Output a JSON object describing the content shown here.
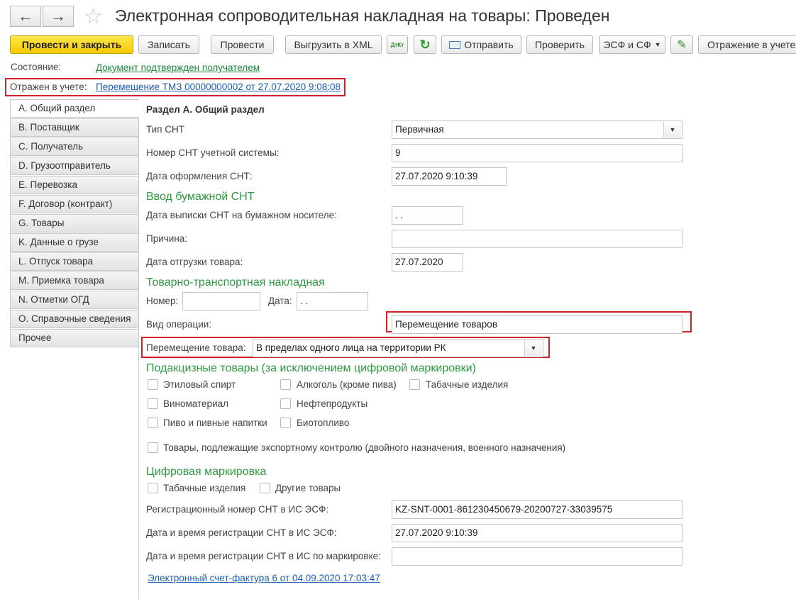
{
  "window": {
    "title": "Электронная сопроводительная накладная на товары: Проведен"
  },
  "toolbar": {
    "post_close": "Провести и закрыть",
    "save": "Записать",
    "post": "Провести",
    "export_xml": "Выгрузить в XML",
    "dtkt_icon_text": "ДтКт",
    "send": "Отправить",
    "check": "Проверить",
    "esf": "ЭСФ и СФ",
    "reflection": "Отражение в учете"
  },
  "status": {
    "label": "Состояние:",
    "value": "Документ подтвержден получателем"
  },
  "reflected": {
    "label": "Отражен в учете:",
    "value": "Перемещение ТМЗ 00000000002 от 27.07.2020 9:08:08"
  },
  "sections": [
    {
      "label": "А. Общий раздел"
    },
    {
      "label": "В. Поставщик"
    },
    {
      "label": "С. Получатель"
    },
    {
      "label": "D. Грузоотправитель"
    },
    {
      "label": "Е. Перевозка"
    },
    {
      "label": "F. Договор (контракт)"
    },
    {
      "label": "G. Товары"
    },
    {
      "label": "K. Данные о грузе"
    },
    {
      "label": "L. Отпуск товара"
    },
    {
      "label": "M. Приемка товара"
    },
    {
      "label": "N. Отметки ОГД"
    },
    {
      "label": "O. Справочные сведения"
    },
    {
      "label": "Прочее"
    }
  ],
  "form": {
    "heading": "Раздел А. Общий раздел",
    "snt_type": {
      "label": "Тип СНТ",
      "value": "Первичная"
    },
    "snt_number": {
      "label": "Номер СНТ учетной системы:",
      "value": "9"
    },
    "snt_date": {
      "label": "Дата оформления СНТ:",
      "value": "27.07.2020  9:10:39"
    },
    "paper_heading": "Ввод бумажной СНТ",
    "paper_date": {
      "label": "Дата выписки СНТ на бумажном носителе:",
      "value": " .  ."
    },
    "reason": {
      "label": "Причина:",
      "value": ""
    },
    "shipment_date": {
      "label": "Дата отгрузки товара:",
      "value": "27.07.2020"
    },
    "ttn_heading": "Товарно-транспортная накладная",
    "ttn_number": {
      "label": "Номер:",
      "value": ""
    },
    "ttn_date": {
      "label": "Дата:",
      "value": " .  ."
    },
    "operation": {
      "label": "Вид операции:",
      "value": "Перемещение товаров"
    },
    "movement": {
      "label": "Перемещение товара:",
      "value": "В пределах одного лица на территории РК"
    },
    "excise_heading": "Подакцизные товары (за исключением цифровой маркировки)",
    "excise": {
      "ethyl": "Этиловый спирт",
      "alcohol": "Алкоголь (кроме пива)",
      "tobacco": "Табачные изделия",
      "wine": "Виноматериал",
      "oil": "Нефтепродукты",
      "beer": "Пиво и пивные напитки",
      "biofuel": "Биотопливо",
      "export_control": "Товары, подлежащие экспортному контролю (двойного назначения, военного назначения)"
    },
    "digital_heading": "Цифровая маркировка",
    "digital": {
      "tobacco": "Табачные изделия",
      "other": "Другие товары"
    },
    "reg_number": {
      "label": "Регистрационный номер СНТ в ИС ЭСФ:",
      "value": "KZ-SNT-0001-861230450679-20200727-33039575"
    },
    "reg_date": {
      "label": "Дата и время регистрации СНТ в ИС ЭСФ:",
      "value": "27.07.2020  9:10:39"
    },
    "reg_date_marking": {
      "label": "Дата и время регистрации СНТ в ИС по маркировке:",
      "value": ""
    },
    "invoice_link": "Электронный счет-фактура 6 от 04.09.2020 17:03:47"
  },
  "colors": {
    "accent_yellow": "#f5c800",
    "section_green": "#2d9a3e",
    "highlight_red": "#d0212b",
    "link_blue": "#1a5fb4"
  }
}
